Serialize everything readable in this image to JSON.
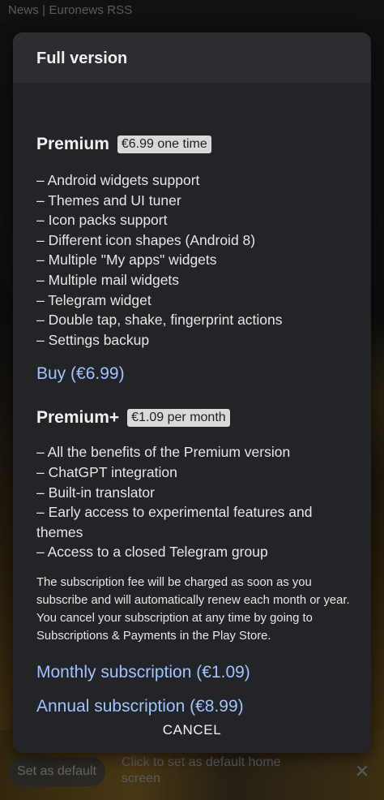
{
  "background": {
    "app_title": "News | Euronews RSS",
    "set_default_label": "Set as default",
    "hint_text": "Click to set as default home screen",
    "close_glyph": "✕"
  },
  "dialog": {
    "title": "Full version",
    "premium": {
      "name": "Premium",
      "price": "€6.99 one time",
      "features": [
        "– Android widgets support",
        "– Themes and UI tuner",
        "– Icon packs support",
        "– Different icon shapes (Android 8)",
        "– Multiple \"My apps\" widgets",
        "– Multiple mail widgets",
        "– Telegram widget",
        "– Double tap, shake, fingerprint actions",
        "– Settings backup"
      ],
      "buy_label": "Buy (€6.99)"
    },
    "premium_plus": {
      "name": "Premium+",
      "price": "€1.09 per month",
      "features": [
        "– All the benefits of the Premium version",
        "– ChatGPT integration",
        "– Built-in translator",
        "– Early access to experimental features and themes",
        "– Access to a closed Telegram group"
      ],
      "note": "The subscription fee will be charged as soon as you subscribe and will automatically renew each month or year. You cancel your subscription at any time by going to Subscriptions & Payments in the Play Store.",
      "monthly_label": "Monthly subscription (€1.09)",
      "annual_label": "Annual subscription (€8.99)"
    },
    "cancel_label": "CANCEL"
  },
  "colors": {
    "dialog_bg": "#232427",
    "header_bg": "#2c2d31",
    "link": "#9ec3ff",
    "badge_bg": "#d9d9d9"
  }
}
